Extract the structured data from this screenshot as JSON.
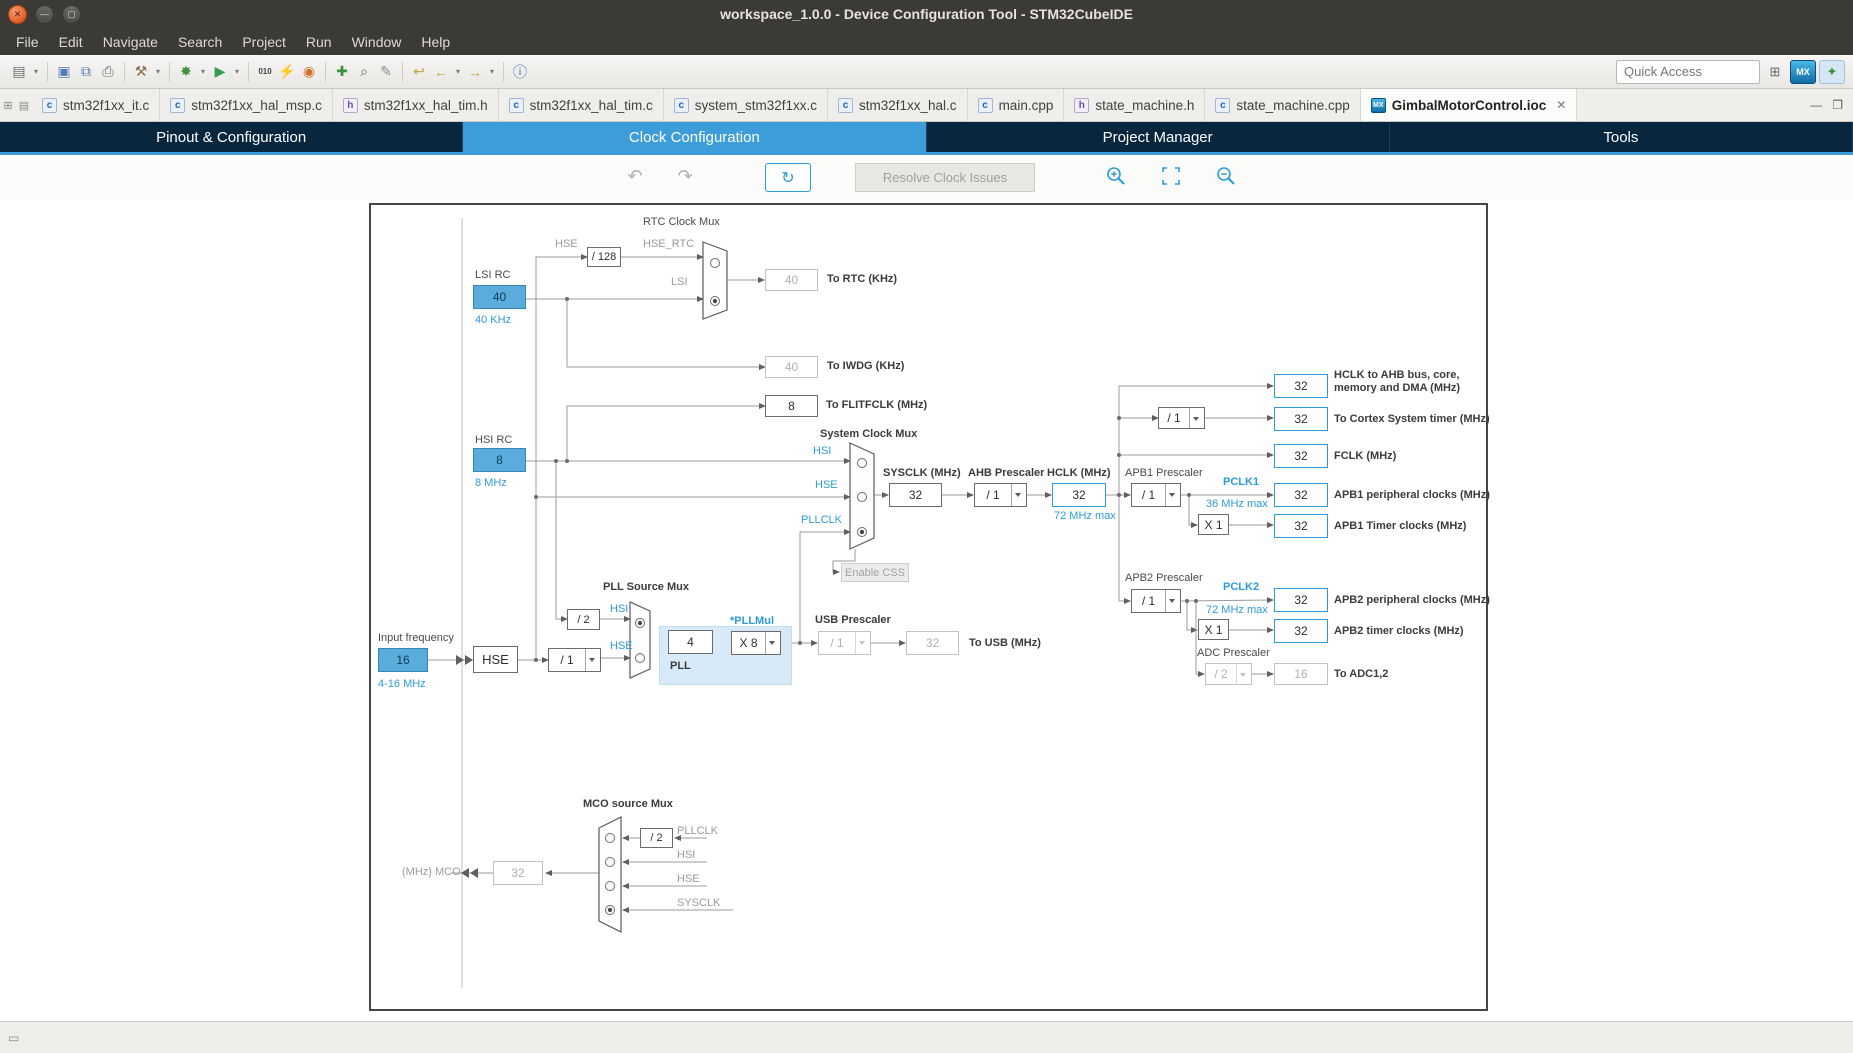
{
  "window": {
    "title": "workspace_1.0.0 - Device Configuration Tool - STM32CubeIDE",
    "controls": {
      "close": "✕",
      "minimize": "—",
      "maximize": "▢"
    }
  },
  "menubar": {
    "items": [
      "File",
      "Edit",
      "Navigate",
      "Search",
      "Project",
      "Run",
      "Window",
      "Help"
    ]
  },
  "toolbar": {
    "quick_access": "Quick Access",
    "icons": [
      {
        "name": "new-wizard-icon",
        "glyph": "▤"
      },
      {
        "name": "new-wizard-dropdown-icon",
        "glyph": "▾"
      },
      {
        "name": "save-icon",
        "glyph": "▣"
      },
      {
        "name": "save-all-icon",
        "glyph": "⧉"
      },
      {
        "name": "print-icon",
        "glyph": "⎙"
      },
      {
        "name": "build-icon",
        "glyph": "⚒"
      },
      {
        "name": "build-dropdown-icon",
        "glyph": "▾"
      },
      {
        "name": "debug-icon",
        "glyph": "✸"
      },
      {
        "name": "debug-dropdown-icon",
        "glyph": "▾"
      },
      {
        "name": "run-icon",
        "glyph": "▶"
      },
      {
        "name": "run-dropdown-icon",
        "glyph": "▾"
      },
      {
        "name": "binary-icon",
        "glyph": "010"
      },
      {
        "name": "flash-download-icon",
        "glyph": "⚡"
      },
      {
        "name": "browser-icon",
        "glyph": "◉"
      },
      {
        "name": "new-cpp-class-icon",
        "glyph": "✚"
      },
      {
        "name": "search-icon",
        "glyph": "⌕"
      },
      {
        "name": "annotation-icon",
        "glyph": "✎"
      },
      {
        "name": "last-edit-icon",
        "glyph": "↩"
      },
      {
        "name": "back-icon",
        "glyph": "←"
      },
      {
        "name": "back-dropdown-icon",
        "glyph": "▾"
      },
      {
        "name": "forward-icon",
        "glyph": "→"
      },
      {
        "name": "forward-dropdown-icon",
        "glyph": "▾"
      },
      {
        "name": "info-icon",
        "glyph": "ⓘ"
      }
    ],
    "perspectives": [
      {
        "name": "open-perspective-icon",
        "glyph": "⊞"
      },
      {
        "name": "cubemx-perspective-icon",
        "glyph": "MX"
      },
      {
        "name": "debug-perspective-icon",
        "glyph": "✦"
      }
    ]
  },
  "editor": {
    "left_icons": [
      {
        "name": "restore-left-panel-icon",
        "glyph": "⊞"
      },
      {
        "name": "editor-switch-icon",
        "glyph": "▤"
      }
    ],
    "close_glyph": "✕",
    "controls": {
      "minimize": "—",
      "maximize": "❐"
    },
    "tabs": [
      {
        "icon_text": "c",
        "label": "stm32f1xx_it.c"
      },
      {
        "icon_text": "c",
        "label": "stm32f1xx_hal_msp.c"
      },
      {
        "icon_text": "h",
        "label": "stm32f1xx_hal_tim.h"
      },
      {
        "icon_text": "c",
        "label": "stm32f1xx_hal_tim.c"
      },
      {
        "icon_text": "c",
        "label": "system_stm32f1xx.c"
      },
      {
        "icon_text": "c",
        "label": "stm32f1xx_hal.c"
      },
      {
        "icon_text": "c",
        "label": "main.cpp"
      },
      {
        "icon_text": "h",
        "label": "state_machine.h"
      },
      {
        "icon_text": "c",
        "label": "state_machine.cpp"
      },
      {
        "icon_text": "MX",
        "label": "GimbalMotorControl.ioc"
      }
    ]
  },
  "config_tabs": {
    "items": [
      {
        "label": "Pinout & Configuration"
      },
      {
        "label": "Clock Configuration"
      },
      {
        "label": "Project Manager"
      },
      {
        "label": "Tools"
      }
    ]
  },
  "clock_toolbar": {
    "undo_glyph": "↶",
    "redo_glyph": "↷",
    "reset_glyph": "↻",
    "resolve_label": "Resolve Clock Issues"
  },
  "colors": {
    "accent_blue": "#3D9DD8",
    "navy": "#08263E",
    "box_fill_blue": "#5AACDC"
  },
  "diagram": {
    "rtc_title": "RTC Clock Mux",
    "rtc_hse": "HSE",
    "rtc_div": "/ 128",
    "rtc_hse_rtc": "HSE_RTC",
    "rtc_lsi": "LSI",
    "rtc_value": "40",
    "rtc_label": "To RTC (KHz)",
    "lsi_label": "LSI RC",
    "lsi_value": "40",
    "lsi_freq": "40 KHz",
    "iwdg_value": "40",
    "iwdg_label": "To IWDG (KHz)",
    "flitf_value": "8",
    "flitf_label": "To FLITFCLK (MHz)",
    "hsi_label": "HSI RC",
    "hsi_value": "8",
    "hsi_freq": "8 MHz",
    "sysmux_title": "System Clock Mux",
    "sysmux_hsi": "HSI",
    "sysmux_hse": "HSE",
    "sysmux_pllclk": "PLLCLK",
    "css_button": "Enable CSS",
    "sysclk_label": "SYSCLK (MHz)",
    "sysclk_value": "32",
    "ahb_label": "AHB Prescaler",
    "ahb_value": "/ 1",
    "hclk_label": "HCLK (MHz)",
    "hclk_value": "32",
    "hclk_max": "72 MHz max",
    "ahb_bus_value": "32",
    "ahb_bus_label": "HCLK to AHB bus, core,\nmemory and DMA (MHz)",
    "cortex_presc": "/ 1",
    "cortex_value": "32",
    "cortex_label": "To Cortex System timer (MHz)",
    "fclk_value": "32",
    "fclk_label": "FCLK (MHz)",
    "apb1_label": "APB1 Prescaler",
    "apb1_presc": "/ 1",
    "pclk1_label": "PCLK1",
    "pclk1_max": "36 MHz max",
    "apb1_value": "32",
    "apb1_periph_label": "APB1 peripheral clocks (MHz)",
    "apb1_mult": "X 1",
    "apb1_timer_value": "32",
    "apb1_timer_label": "APB1 Timer clocks (MHz)",
    "apb2_label": "APB2 Prescaler",
    "apb2_presc": "/ 1",
    "pclk2_label": "PCLK2",
    "pclk2_max": "72 MHz max",
    "apb2_value": "32",
    "apb2_periph_label": "APB2 peripheral clocks (MHz)",
    "apb2_mult": "X 1",
    "apb2_timer_value": "32",
    "apb2_timer_label": "APB2 timer clocks (MHz)",
    "adc_label": "ADC Prescaler",
    "adc_presc": "/ 2",
    "adc_value": "16",
    "adc_to_label": "To ADC1,2",
    "pllmux_title": "PLL Source Mux",
    "pll_div2": "/ 2",
    "pllmux_hsi": "HSI",
    "pllmux_hse": "HSE",
    "pll_label": "PLL",
    "pll_input_value": "4",
    "pllmul_label": "*PLLMul",
    "pllmul_value": "X 8",
    "input_label": "Input frequency",
    "input_value": "16",
    "input_range": "4-16 MHz",
    "hse_box": "HSE",
    "hse_prediv": "/ 1",
    "usb_label": "USB Prescaler",
    "usb_presc": "/ 1",
    "usb_value": "32",
    "usb_to_label": "To USB (MHz)",
    "mco_title": "MCO source Mux",
    "mco_div": "/ 2",
    "mco_pllclk": "PLLCLK",
    "mco_hsi": "HSI",
    "mco_hse": "HSE",
    "mco_sysclk": "SYSCLK",
    "mco_value": "32",
    "mco_label": "(MHz) MCO"
  }
}
